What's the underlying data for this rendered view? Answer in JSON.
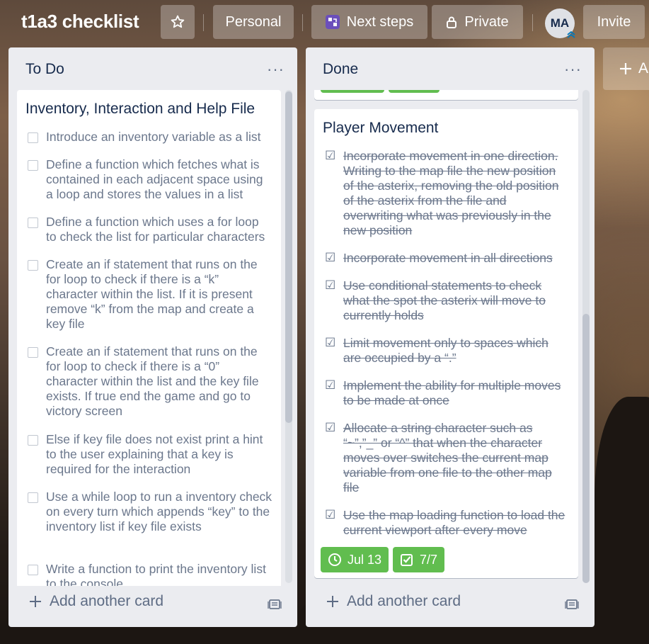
{
  "board": {
    "title": "t1a3 checklist",
    "personal_label": "Personal",
    "next_steps_label": "Next steps",
    "private_label": "Private",
    "avatar_initials": "MA",
    "invite_label": "Invite",
    "add_list_label": "A"
  },
  "lists": [
    {
      "title": "To Do",
      "add_card_label": "Add another card",
      "card": {
        "title": "Inventory, Interaction and Help File",
        "items": [
          "Introduce an inventory variable as a list",
          "Define a function which fetches what is contained in each adjacent space using a loop and stores the values in a list",
          "Define a function which uses a for loop to check the list for particular characters",
          "Create an if statement that runs on the for loop to check if there is a “k” character within the list. If it is present remove “k” from the map and create a key file",
          "Create an if statement that runs on the for loop to check if there is a “0” character within the list and the key file exists. If true end the game and go to victory screen",
          "Else if key file does not exist print a hint to the user explaining that a key is required for the interaction",
          "Use a while loop to run a inventory check on every turn which appends “key” to the inventory list if key file exists",
          "Write a function to print the inventory list to the console"
        ]
      }
    },
    {
      "title": "Done",
      "add_card_label": "Add another card",
      "card": {
        "title": "Player Movement",
        "items": [
          "Incorporate movement in one direction. Writing to the map file the new position of the asterix, removing the old position of the asterix from the file and overwriting what was previously in the new position",
          "Incorporate movement in all directions",
          "Use conditional statements to check what the spot the asterix will move to currently holds",
          "Limit movement only to spaces which are occupied by a “.”",
          "Implement the ability for multiple moves to be made at once",
          "Allocate a string character such as “~”,”_” or “^” that when the character moves over switches the current map variable from one file to the other map file",
          "Use the map loading function to load the current viewport after every move"
        ],
        "due_label": "Jul 13",
        "checklist_label": "7/7"
      }
    }
  ],
  "colors": {
    "badge_green": "#61bd4f",
    "list_bg": "#ebecf0",
    "text_dark": "#172b4d",
    "text_muted": "#6b778c"
  },
  "icons": [
    "star-icon",
    "powerup-icon",
    "lock-icon",
    "more-icon",
    "plus-icon",
    "template-icon",
    "clock-icon",
    "checklist-icon"
  ]
}
